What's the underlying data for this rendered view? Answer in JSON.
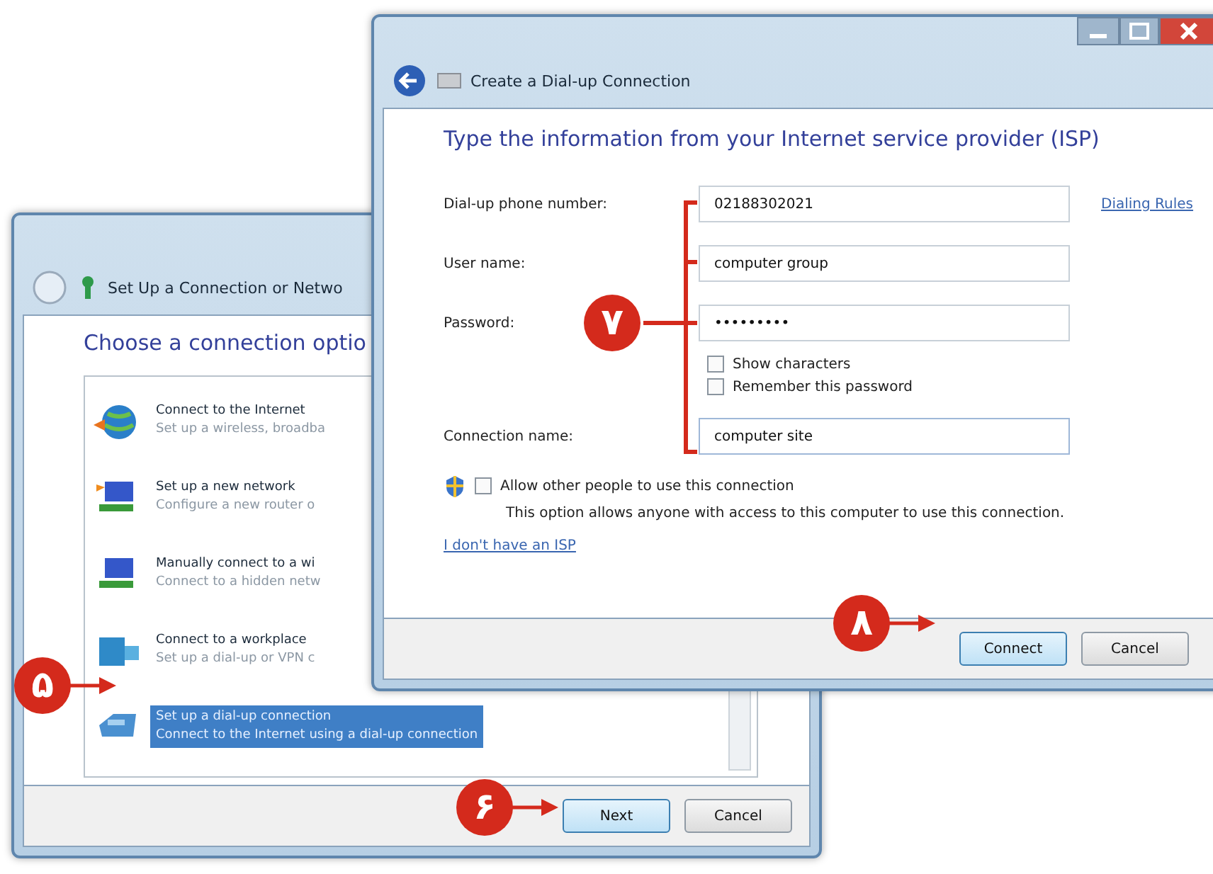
{
  "back_window": {
    "title": "Set Up a Connection or Netwo",
    "heading": "Choose a connection optio",
    "options": [
      {
        "title": "Connect to the Internet",
        "description": "Set up a wireless, broadba",
        "selected": false
      },
      {
        "title": "Set up a new network",
        "description": "Configure a new router o",
        "selected": false
      },
      {
        "title": "Manually connect to a wi",
        "description": "Connect to a hidden netw",
        "selected": false
      },
      {
        "title": "Connect to a workplace",
        "description": "Set up a dial-up or VPN c",
        "selected": false
      },
      {
        "title": "Set up a dial-up connection",
        "description": "Connect to the Internet using a dial-up connection",
        "selected": true
      }
    ],
    "buttons": [
      {
        "label": "Next",
        "default": true
      },
      {
        "label": "Cancel",
        "default": false
      }
    ]
  },
  "front_window": {
    "title": "Create a Dial-up Connection",
    "heading": "Type the information from your Internet service provider (ISP)",
    "fields": [
      {
        "label": "Dial-up phone number:",
        "value": "02188302021"
      },
      {
        "label": "User name:",
        "value": "computer group"
      },
      {
        "label": "Password:",
        "value": "•••••••••"
      }
    ],
    "dialing_rules_link": "Dialing Rules",
    "checkboxes": [
      {
        "label": "Show characters",
        "checked": false
      },
      {
        "label": "Remember this password",
        "checked": false
      }
    ],
    "connection_name": {
      "label": "Connection name:",
      "value": "computer site"
    },
    "allow_option": {
      "label": "Allow other people to use this connection",
      "checked": false,
      "note": "This option allows anyone with access to this computer to use this connection."
    },
    "isp_link": "I don't have an ISP",
    "buttons": [
      {
        "label": "Connect",
        "default": true
      },
      {
        "label": "Cancel",
        "default": false
      }
    ]
  },
  "step_markers": [
    {
      "label": "۵",
      "kind": "arrow"
    },
    {
      "label": "۶",
      "kind": "arrow"
    },
    {
      "label": "۷",
      "kind": "bracket"
    },
    {
      "label": "۸",
      "kind": "arrow"
    }
  ]
}
